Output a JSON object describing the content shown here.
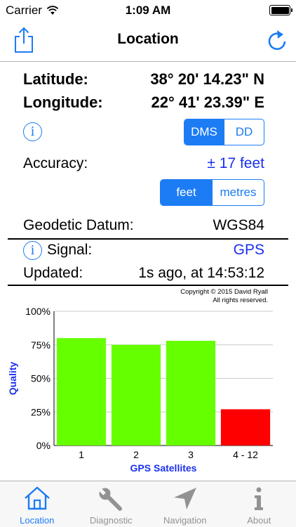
{
  "status_bar": {
    "carrier": "Carrier",
    "time": "1:09 AM"
  },
  "nav": {
    "title": "Location",
    "left_icon": "share-icon",
    "right_icon": "refresh-icon"
  },
  "coords": {
    "latitude_label": "Latitude:",
    "latitude_value": "38° 20' 14.23\" N",
    "longitude_label": "Longitude:",
    "longitude_value": "22° 41' 23.39\" E"
  },
  "format_toggle": {
    "options": [
      "DMS",
      "DD"
    ],
    "selected": "DMS"
  },
  "accuracy": {
    "label": "Accuracy:",
    "value": "± 17 feet"
  },
  "unit_toggle": {
    "options": [
      "feet",
      "metres"
    ],
    "selected": "feet"
  },
  "datum": {
    "label": "Geodetic Datum:",
    "value": "WGS84"
  },
  "signal": {
    "label": "Signal:",
    "value": "GPS"
  },
  "updated": {
    "label": "Updated:",
    "value": "1s ago, at 14:53:12"
  },
  "copyright": {
    "line1": "Copyright © 2015 David Ryall",
    "line2": "All rights reserved."
  },
  "colors": {
    "accent": "#1c7cf4",
    "good": "#66ff00",
    "bad": "#ff0000",
    "label_blue": "#1a2ff0"
  },
  "chart_data": {
    "type": "bar",
    "categories": [
      "1",
      "2",
      "3",
      "4 - 12"
    ],
    "values": [
      80,
      75,
      78,
      27
    ],
    "bar_colors": [
      "#66ff00",
      "#66ff00",
      "#66ff00",
      "#ff0000"
    ],
    "yticks": [
      "0%",
      "25%",
      "50%",
      "75%",
      "100%"
    ],
    "ylim": [
      0,
      100
    ],
    "xlabel": "GPS Satellites",
    "ylabel": "Quality",
    "grid": true
  },
  "tabs": [
    {
      "label": "Location",
      "icon": "home-icon",
      "active": true
    },
    {
      "label": "Diagnostic",
      "icon": "wrench-icon",
      "active": false
    },
    {
      "label": "Navigation",
      "icon": "navigation-arrow-icon",
      "active": false
    },
    {
      "label": "About",
      "icon": "info-icon",
      "active": false
    }
  ]
}
